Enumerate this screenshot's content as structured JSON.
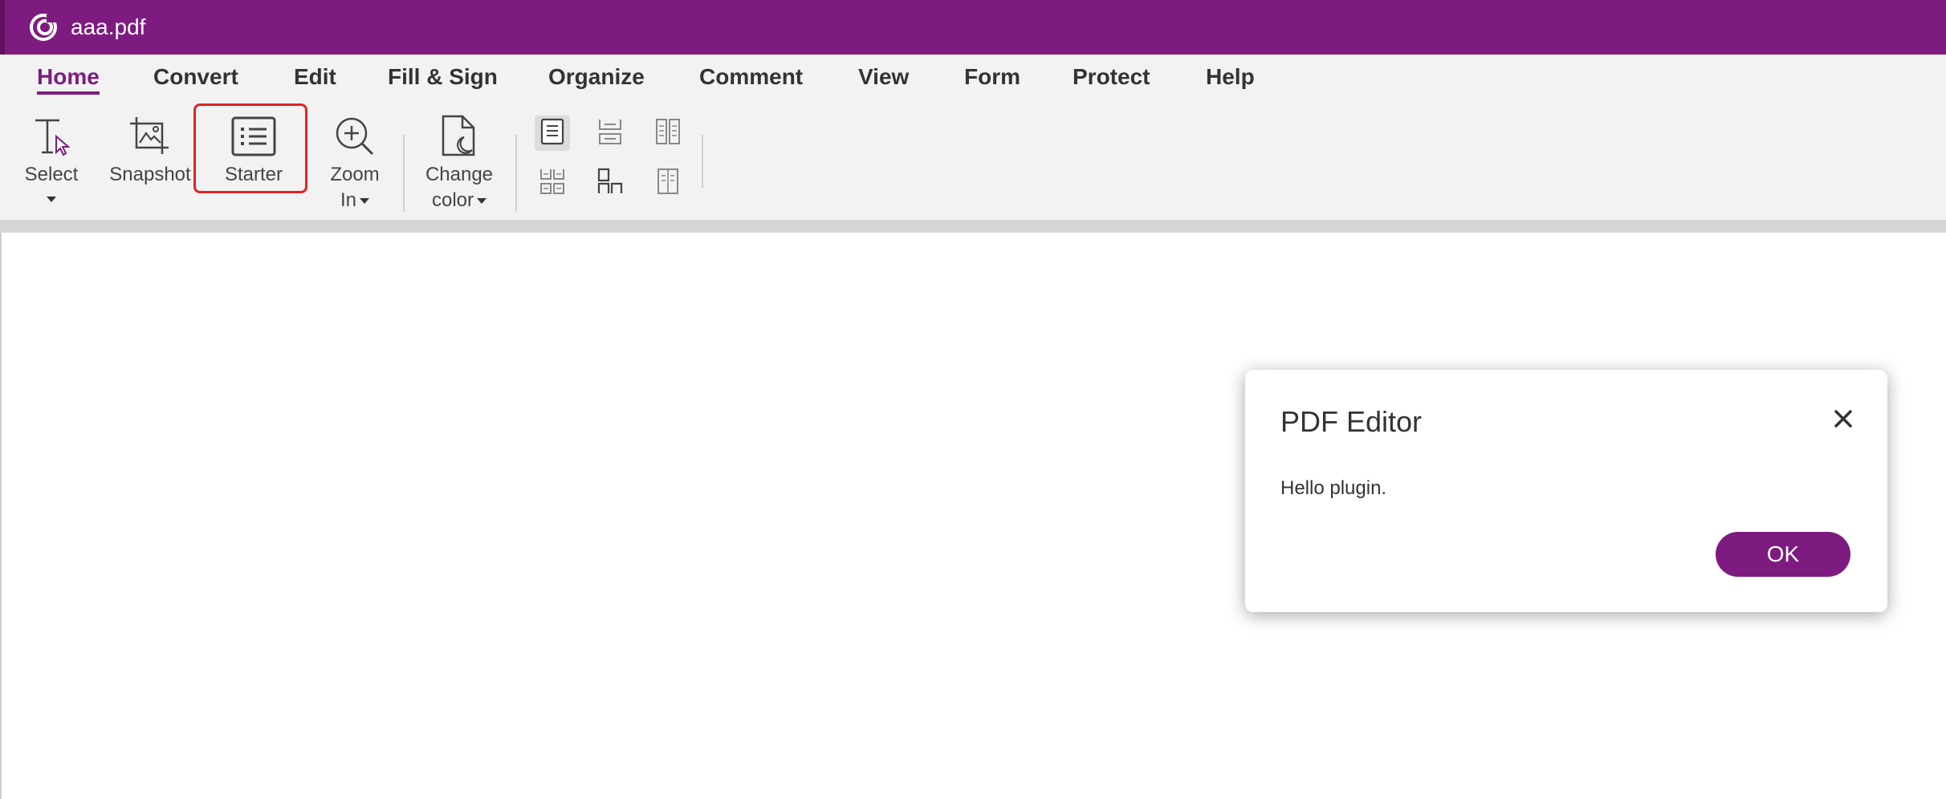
{
  "window": {
    "title": "aaa.pdf",
    "icon": "foxit-logo-icon"
  },
  "menu": {
    "items": [
      {
        "label": "Home",
        "active": true
      },
      {
        "label": "Convert"
      },
      {
        "label": "Edit"
      },
      {
        "label": "Fill & Sign"
      },
      {
        "label": "Organize"
      },
      {
        "label": "Comment"
      },
      {
        "label": "View"
      },
      {
        "label": "Form"
      },
      {
        "label": "Protect"
      },
      {
        "label": "Help"
      }
    ]
  },
  "toolbar": {
    "select": {
      "label": "Select",
      "icon": "text-select-icon"
    },
    "snapshot": {
      "label": "Snapshot",
      "icon": "snapshot-icon"
    },
    "starter": {
      "label": "Starter",
      "icon": "list-icon"
    },
    "zoom": {
      "label_line1": "Zoom",
      "label_line2": "In",
      "icon": "zoom-in-icon"
    },
    "change_color": {
      "label_line1": "Change",
      "label_line2": "color",
      "icon": "page-color-icon"
    },
    "layouts": [
      "single-page-icon",
      "continuous-page-icon",
      "facing-page-icon",
      "continuous-facing-icon",
      "cover-page-icon",
      "separate-cover-icon"
    ]
  },
  "dialog": {
    "title": "PDF Editor",
    "message": "Hello plugin.",
    "ok_label": "OK"
  },
  "colors": {
    "brand": "#7e1b80",
    "highlight": "#e02424",
    "toolbar_bg": "#f2f2f2"
  }
}
